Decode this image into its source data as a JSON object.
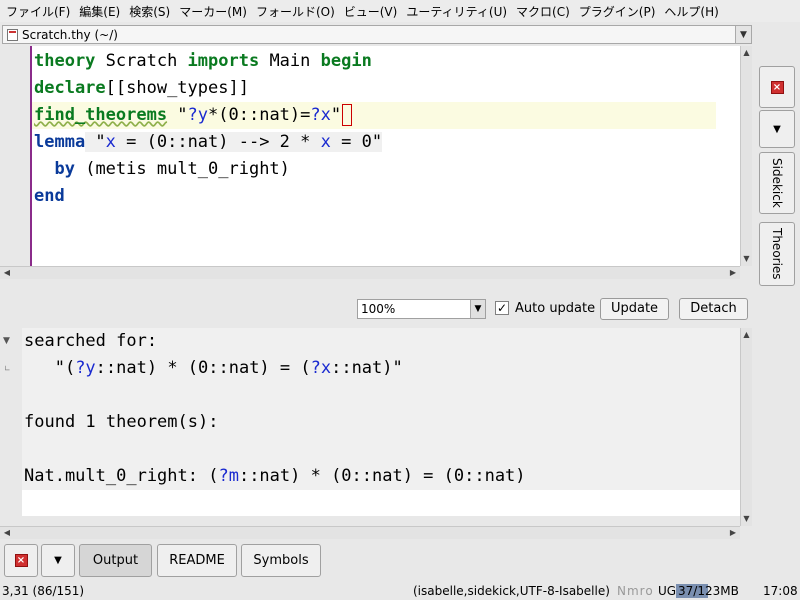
{
  "menu": [
    "ファイル(F)",
    "編集(E)",
    "検索(S)",
    "マーカー(M)",
    "フォールド(O)",
    "ビュー(V)",
    "ユーティリティ(U)",
    "マクロ(C)",
    "プラグイン(P)",
    "ヘルプ(H)"
  ],
  "buffer": {
    "title": "Scratch.thy (~/)"
  },
  "editor": {
    "l1": {
      "theory": "theory",
      "name": " Scratch ",
      "imports": "imports",
      "main": " Main ",
      "begin": "begin"
    },
    "l2": {
      "declare": "declare",
      "rest": "[[show_types]]"
    },
    "l3": {
      "find": "find_theorems",
      "q1": " \"",
      "y": "?y",
      "mid": "*(0::nat)=",
      "x": "?x",
      "q2": "\""
    },
    "l4": {
      "lemma": "lemma",
      "a": " \"",
      "x1": "x",
      "b": " = (0::nat) --> 2 * ",
      "x2": "x",
      "c": " = 0\""
    },
    "l5": {
      "indent": "  ",
      "by": "by",
      "rest": " (metis mult_0_right)"
    },
    "l6": {
      "end": "end"
    }
  },
  "output_toolbar": {
    "zoom": "100%",
    "auto_update_label": "Auto update",
    "auto_update_checked": "✓",
    "update_label": "Update",
    "detach_label": "Detach"
  },
  "output": {
    "l1": "searched for:",
    "l2": {
      "a": "   \"(",
      "y": "?y",
      "b": "::nat) * (0::nat) = (",
      "x": "?x",
      "c": "::nat)\""
    },
    "l4": "found 1 theorem(s):",
    "l6": {
      "a": "Nat.mult_0_right: (",
      "m": "?m",
      "b": "::nat) * (0::nat) = (0::nat)"
    }
  },
  "right_dock": {
    "sidekick": "Sidekick",
    "theories": "Theories"
  },
  "bottom_dock": {
    "output": "Output",
    "readme": "README",
    "symbols": "Symbols"
  },
  "status": {
    "position": "3,31 (86/151)",
    "mode": "(isabelle,sidekick,UTF-8-Isabelle)",
    "flags": "Nmro",
    "ug": "UG",
    "memory": " 37/123MB",
    "time": "17:08"
  }
}
